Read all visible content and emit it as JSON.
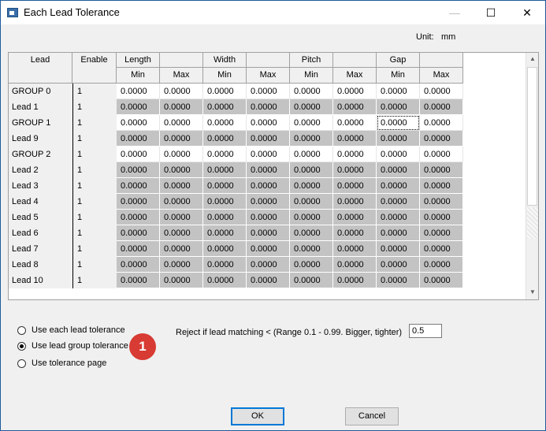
{
  "window": {
    "title": "Each Lead Tolerance",
    "controls": {
      "minimize": "—",
      "maximize": "☐",
      "close": "✕"
    }
  },
  "unit": {
    "label": "Unit:",
    "value": "mm"
  },
  "table": {
    "header_top": [
      "Lead",
      "Enable",
      "Length",
      "",
      "Width",
      "",
      "Pitch",
      "",
      "Gap",
      ""
    ],
    "header_sub": [
      "",
      "",
      "Min",
      "Max",
      "Min",
      "Max",
      "Min",
      "Max",
      "Min",
      "Max"
    ],
    "rows": [
      {
        "name": "GROUP 0",
        "enable": "1",
        "editable": true,
        "values": [
          "0.0000",
          "0.0000",
          "0.0000",
          "0.0000",
          "0.0000",
          "0.0000",
          "0.0000",
          "0.0000"
        ]
      },
      {
        "name": "Lead 1",
        "enable": "1",
        "editable": false,
        "values": [
          "0.0000",
          "0.0000",
          "0.0000",
          "0.0000",
          "0.0000",
          "0.0000",
          "0.0000",
          "0.0000"
        ]
      },
      {
        "name": "GROUP 1",
        "enable": "1",
        "editable": true,
        "values": [
          "0.0000",
          "0.0000",
          "0.0000",
          "0.0000",
          "0.0000",
          "0.0000",
          "0.0000",
          "0.0000"
        ]
      },
      {
        "name": "Lead 9",
        "enable": "1",
        "editable": false,
        "values": [
          "0.0000",
          "0.0000",
          "0.0000",
          "0.0000",
          "0.0000",
          "0.0000",
          "0.0000",
          "0.0000"
        ]
      },
      {
        "name": "GROUP 2",
        "enable": "1",
        "editable": true,
        "values": [
          "0.0000",
          "0.0000",
          "0.0000",
          "0.0000",
          "0.0000",
          "0.0000",
          "0.0000",
          "0.0000"
        ]
      },
      {
        "name": "Lead 2",
        "enable": "1",
        "editable": false,
        "values": [
          "0.0000",
          "0.0000",
          "0.0000",
          "0.0000",
          "0.0000",
          "0.0000",
          "0.0000",
          "0.0000"
        ]
      },
      {
        "name": "Lead 3",
        "enable": "1",
        "editable": false,
        "values": [
          "0.0000",
          "0.0000",
          "0.0000",
          "0.0000",
          "0.0000",
          "0.0000",
          "0.0000",
          "0.0000"
        ]
      },
      {
        "name": "Lead 4",
        "enable": "1",
        "editable": false,
        "values": [
          "0.0000",
          "0.0000",
          "0.0000",
          "0.0000",
          "0.0000",
          "0.0000",
          "0.0000",
          "0.0000"
        ]
      },
      {
        "name": "Lead 5",
        "enable": "1",
        "editable": false,
        "values": [
          "0.0000",
          "0.0000",
          "0.0000",
          "0.0000",
          "0.0000",
          "0.0000",
          "0.0000",
          "0.0000"
        ]
      },
      {
        "name": "Lead 6",
        "enable": "1",
        "editable": false,
        "values": [
          "0.0000",
          "0.0000",
          "0.0000",
          "0.0000",
          "0.0000",
          "0.0000",
          "0.0000",
          "0.0000"
        ]
      },
      {
        "name": "Lead 7",
        "enable": "1",
        "editable": false,
        "values": [
          "0.0000",
          "0.0000",
          "0.0000",
          "0.0000",
          "0.0000",
          "0.0000",
          "0.0000",
          "0.0000"
        ]
      },
      {
        "name": "Lead 8",
        "enable": "1",
        "editable": false,
        "values": [
          "0.0000",
          "0.0000",
          "0.0000",
          "0.0000",
          "0.0000",
          "0.0000",
          "0.0000",
          "0.0000"
        ]
      },
      {
        "name": "Lead 10",
        "enable": "1",
        "editable": false,
        "values": [
          "0.0000",
          "0.0000",
          "0.0000",
          "0.0000",
          "0.0000",
          "0.0000",
          "0.0000",
          "0.0000"
        ]
      }
    ],
    "focused_cell": {
      "row": 2,
      "col": 6
    },
    "scroll_arrows": {
      "up": "▲",
      "down": "▼"
    }
  },
  "options": {
    "radios": [
      {
        "label": "Use each lead tolerance",
        "checked": false
      },
      {
        "label": "Use lead group tolerance",
        "checked": true
      },
      {
        "label": "Use tolerance page",
        "checked": false
      }
    ],
    "badge": "1",
    "reject_label": "Reject if lead matching < (Range 0.1 - 0.99. Bigger, tighter)",
    "reject_value": "0.5"
  },
  "buttons": {
    "ok": "OK",
    "cancel": "Cancel"
  },
  "colors": {
    "editable_cell": "#ffffff",
    "readonly_cell": "#c3c3c3",
    "badge": "#d83a34",
    "default_button_border": "#0078d7"
  }
}
